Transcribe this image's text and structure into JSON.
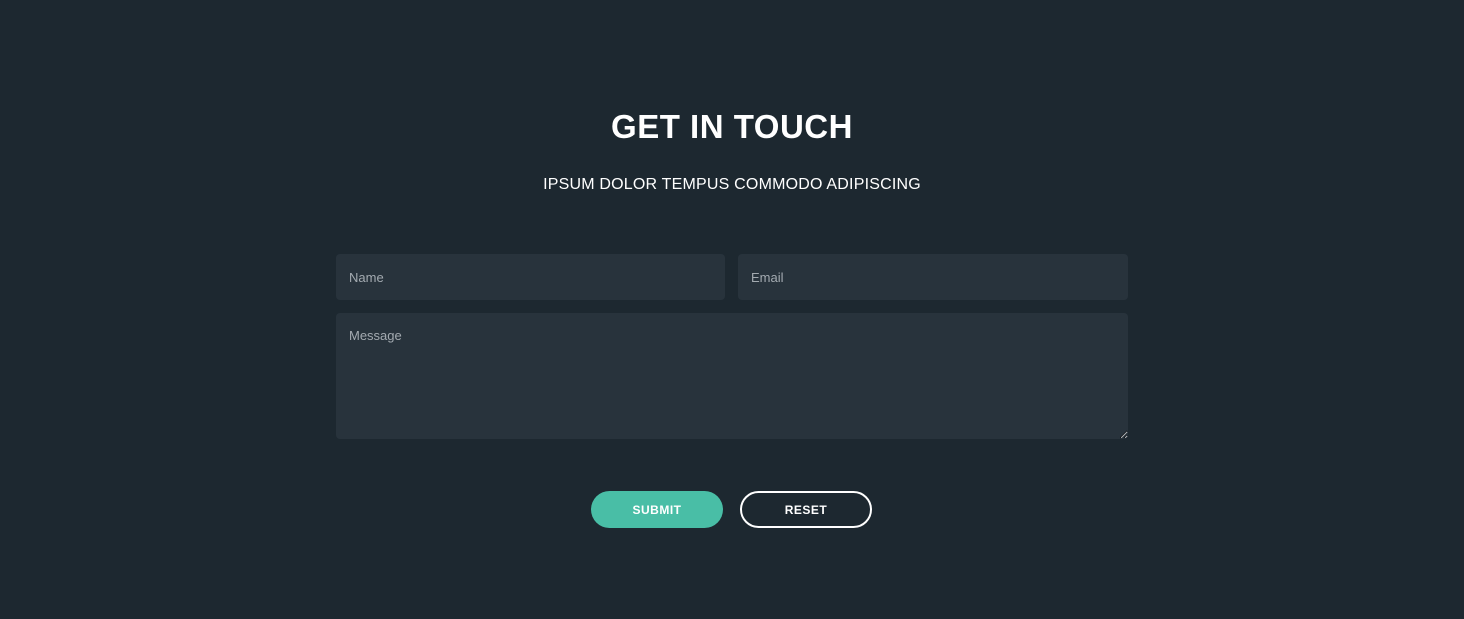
{
  "header": {
    "title": "GET IN TOUCH",
    "subtitle": "IPSUM DOLOR TEMPUS COMMODO ADIPISCING"
  },
  "form": {
    "name_placeholder": "Name",
    "name_value": "",
    "email_placeholder": "Email",
    "email_value": "",
    "message_placeholder": "Message",
    "message_value": "",
    "submit_label": "SUBMIT",
    "reset_label": "RESET"
  },
  "colors": {
    "background": "#1d2830",
    "field_background": "#28333c",
    "accent": "#49bea6",
    "text": "#ffffff",
    "placeholder": "#a3aab0"
  }
}
